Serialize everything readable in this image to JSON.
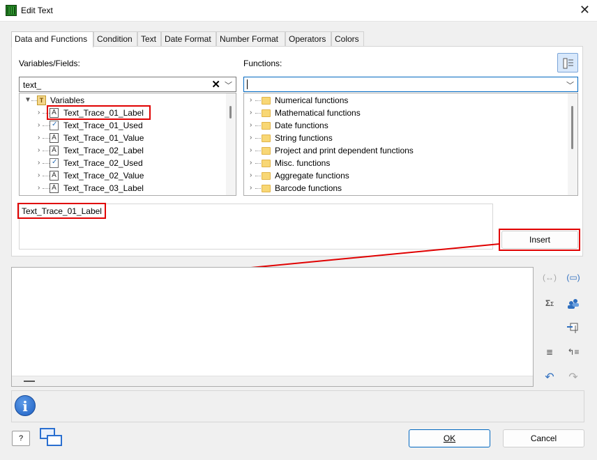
{
  "window": {
    "title": "Edit Text"
  },
  "tabs": [
    "Data and Functions",
    "Condition",
    "Text",
    "Date Format",
    "Number Format",
    "Operators",
    "Colors"
  ],
  "variables": {
    "label": "Variables/Fields:",
    "search_value": "text_",
    "root": "Variables",
    "items": [
      {
        "name": "Text_Trace_01_Label",
        "type": "text"
      },
      {
        "name": "Text_Trace_01_Used",
        "type": "bool"
      },
      {
        "name": "Text_Trace_01_Value",
        "type": "text"
      },
      {
        "name": "Text_Trace_02_Label",
        "type": "text"
      },
      {
        "name": "Text_Trace_02_Used",
        "type": "bool"
      },
      {
        "name": "Text_Trace_02_Value",
        "type": "text"
      },
      {
        "name": "Text_Trace_03_Label",
        "type": "text"
      }
    ]
  },
  "functions": {
    "label": "Functions:",
    "search_value": "",
    "items": [
      "Numerical functions",
      "Mathematical functions",
      "Date functions",
      "String functions",
      "Project and print dependent functions",
      "Misc. functions",
      "Aggregate functions",
      "Barcode functions"
    ]
  },
  "preview": {
    "text": "Text_Trace_01_Label"
  },
  "buttons": {
    "insert": "Insert",
    "ok": "OK",
    "cancel": "Cancel",
    "help": "?"
  },
  "colors": {
    "highlight": "#e00000",
    "accent": "#0067c0"
  }
}
